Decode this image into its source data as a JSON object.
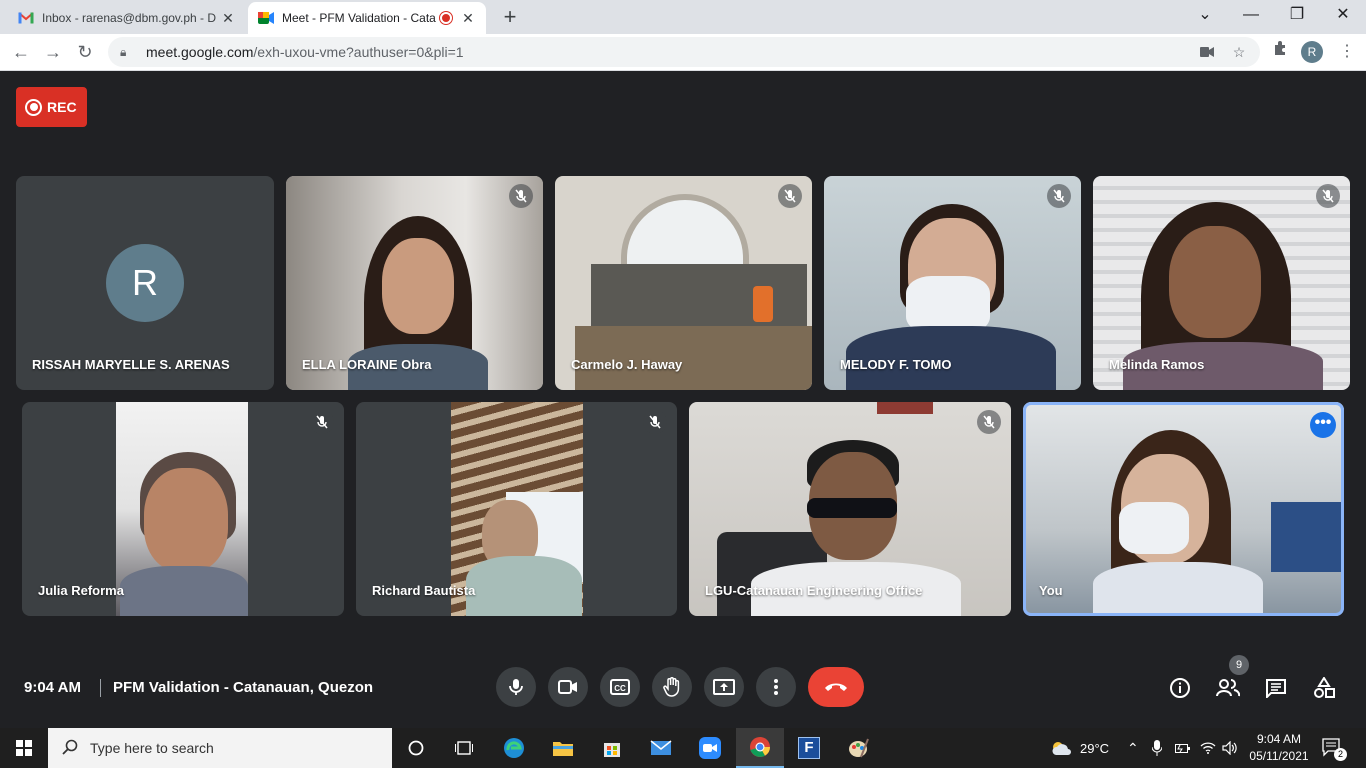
{
  "browser": {
    "tabs": [
      {
        "title": "Inbox - rarenas@dbm.gov.ph - D",
        "active": false
      },
      {
        "title": "Meet - PFM Validation - Cata",
        "active": true
      }
    ],
    "url_host": "meet.google.com",
    "url_path": "/exh-uxou-vme?authuser=0&pli=1",
    "profile_initial": "R",
    "new_tab_label": "+"
  },
  "meet": {
    "rec_label": "REC",
    "participants": [
      {
        "name": "RISSAH MARYELLE S. ARENAS",
        "initial": "R",
        "video": false,
        "muted": false
      },
      {
        "name": "ELLA LORAINE Obra",
        "muted": true
      },
      {
        "name": "Carmelo J. Haway",
        "muted": true
      },
      {
        "name": "MELODY F. TOMO",
        "muted": true
      },
      {
        "name": "Melinda Ramos",
        "muted": true
      },
      {
        "name": "Julia Reforma",
        "muted": true
      },
      {
        "name": "Richard Bautista",
        "muted": true
      },
      {
        "name": "LGU-Catanauan Engineering Office",
        "muted": true
      },
      {
        "name": "You",
        "muted": false,
        "pinned": true
      }
    ],
    "time": "9:04 AM",
    "meeting_name": "PFM Validation - Catanauan, Quezon",
    "participant_count": "9",
    "more_dots": "•••",
    "colors": {
      "rec": "#d93025",
      "end_call": "#ea4335",
      "highlight": "#8ab4f8",
      "bg": "#202124"
    }
  },
  "taskbar": {
    "search_placeholder": "Type here to search",
    "weather": "29°C",
    "clock_time": "9:04 AM",
    "clock_date": "05/11/2021",
    "notification_count": "2",
    "app_f_label": "F"
  }
}
